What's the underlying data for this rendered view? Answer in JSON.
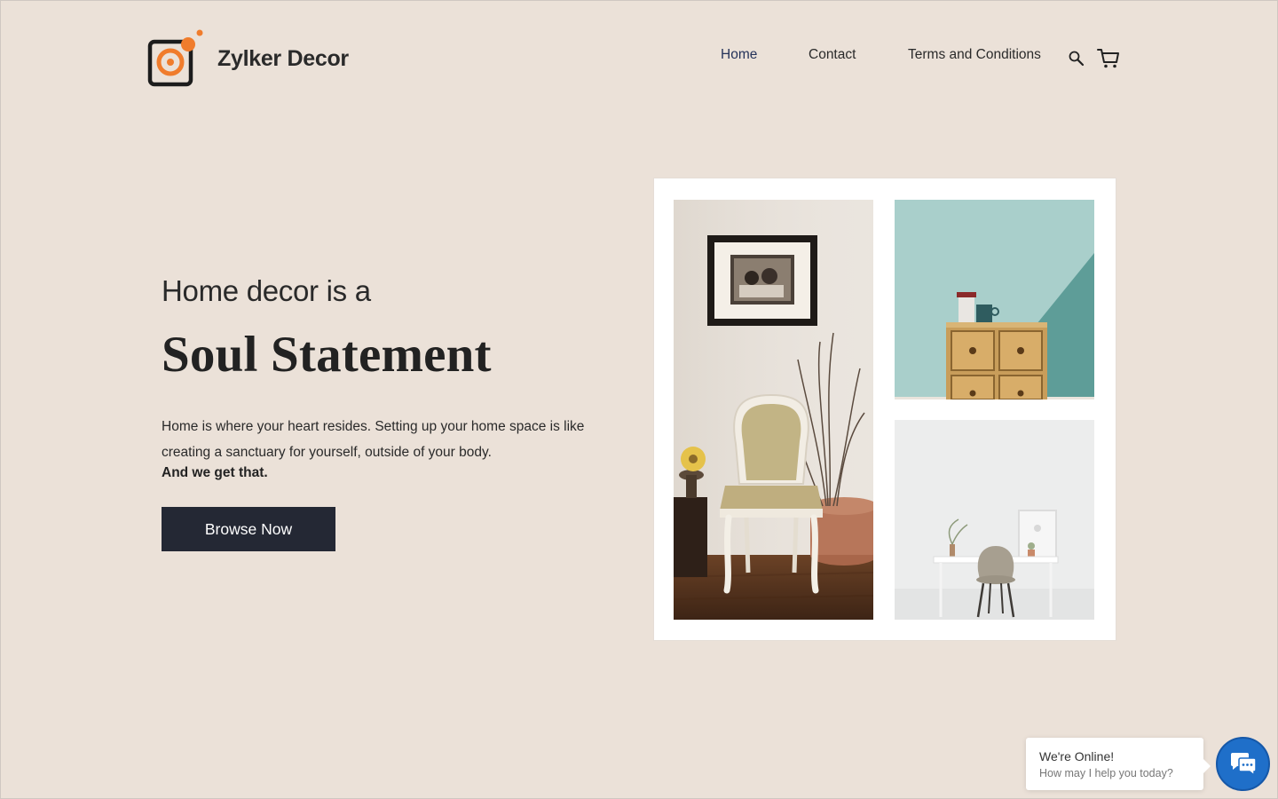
{
  "brand": {
    "name": "Zylker Decor",
    "accent_color": "#f07c2c",
    "logo_icon": "camera-lens-logo"
  },
  "nav": {
    "items": [
      {
        "label": "Home",
        "active": true
      },
      {
        "label": "Contact",
        "active": false
      },
      {
        "label": "Terms and Conditions",
        "active": false
      }
    ],
    "search_icon": "search-icon",
    "cart_icon": "cart-icon",
    "active_color": "#25335a"
  },
  "hero": {
    "pre_title": "Home decor is a",
    "title": "Soul Statement",
    "description": "Home is where your heart resides. Setting up your home space is like creating a sanctuary for yourself, outside of your body.",
    "tagline": "And we get that.",
    "cta_label": "Browse Now",
    "cta_color": "#242834"
  },
  "chat": {
    "title": "We're Online!",
    "subtitle": "How may I help you today?",
    "icon": "chat-bubbles-icon",
    "button_color": "#1f6fc9"
  },
  "colors": {
    "background": "#ebe1d8"
  }
}
